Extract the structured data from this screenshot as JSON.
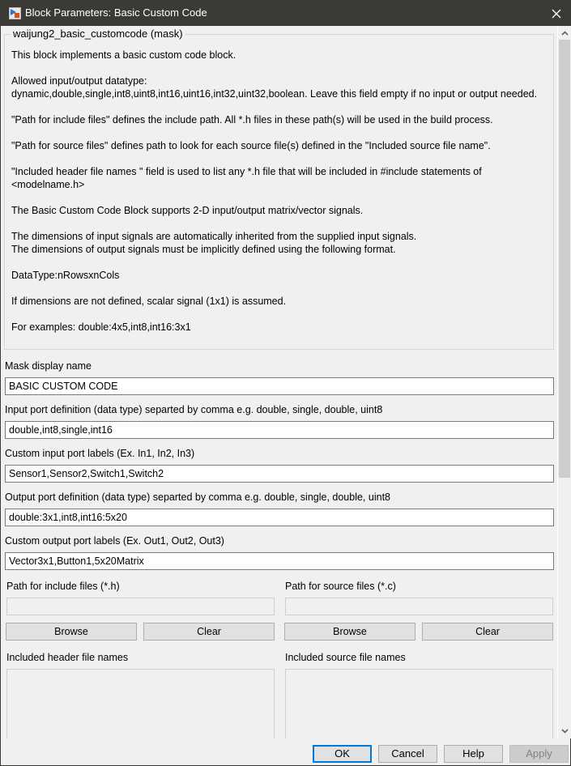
{
  "window": {
    "title": "Block Parameters: Basic Custom Code",
    "icons": {
      "app": "simulink-block-icon",
      "close": "close-icon"
    }
  },
  "description": {
    "group_title": "waijung2_basic_customcode (mask)",
    "paragraphs": [
      "This block implements a basic custom code block.",
      "Allowed input/output datatype:\ndynamic,double,single,int8,uint8,int16,uint16,int32,uint32,boolean. Leave this field empty if no input or output needed.",
      "\"Path for include files\" defines the include path. All *.h files in these path(s) will be used in the build process.",
      "\"Path for source files\" defines path to look for each source file(s) defined in the \"Included source file name\".",
      "\"Included header file names \" field is used to list any *.h file that will be included in #include statements of <modelname.h>",
      "The Basic Custom Code Block supports 2-D input/output matrix/vector signals.",
      "The dimensions of input signals are automatically inherited from the supplied input signals.\nThe dimensions of output signals must be implicitly defined using the following format.",
      "DataType:nRowsxnCols",
      "If dimensions are not defined, scalar signal (1x1) is assumed.",
      "For examples: double:4x5,int8,int16:3x1"
    ]
  },
  "fields": {
    "mask_display_name": {
      "label": "Mask display name",
      "value": "BASIC CUSTOM CODE"
    },
    "input_port_def": {
      "label": "Input port definition (data type) separted by comma e.g. double, single, double, uint8",
      "value": "double,int8,single,int16"
    },
    "input_port_labels": {
      "label": "Custom input port labels (Ex. In1, In2, In3)",
      "value": "Sensor1,Sensor2,Switch1,Switch2"
    },
    "output_port_def": {
      "label": "Output port definition  (data type) separted by comma e.g. double, single, double, uint8",
      "value": "double:3x1,int8,int16:5x20"
    },
    "output_port_labels": {
      "label": "Custom output port labels (Ex. Out1, Out2, Out3)",
      "value": "Vector3x1,Button1,5x20Matrix"
    }
  },
  "include_panel": {
    "path_label": "Path for include files (*.h)",
    "path_value": "",
    "browse_label": "Browse",
    "clear_label": "Clear",
    "list_label": "Included header file names"
  },
  "source_panel": {
    "path_label": "Path for source files (*.c)",
    "path_value": "",
    "browse_label": "Browse",
    "clear_label": "Clear",
    "list_label": "Included source file names"
  },
  "scrollbar": {
    "position_fraction": 0.0,
    "visible_fraction": 0.64
  },
  "footer": {
    "ok_label": "OK",
    "cancel_label": "Cancel",
    "help_label": "Help",
    "apply_label": "Apply",
    "apply_enabled": false,
    "accent_color": "#0078d7"
  }
}
